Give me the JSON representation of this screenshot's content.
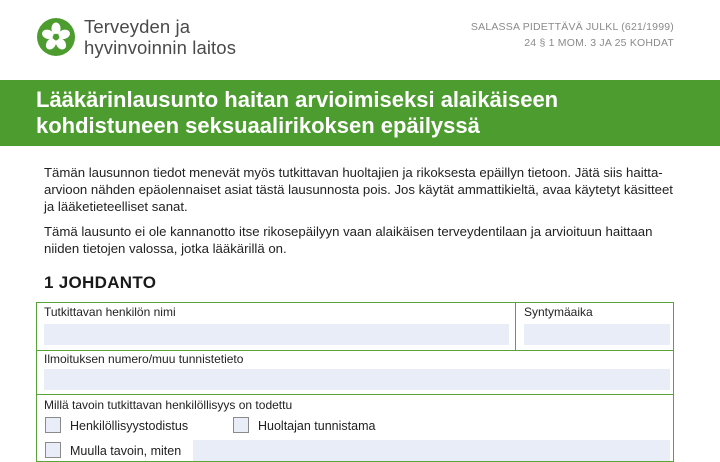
{
  "header": {
    "org_line1": "Terveyden ja",
    "org_line2": "hyvinvoinnin laitos",
    "classification_line1": "SALASSA PIDETTÄVÄ JULKL (621/1999)",
    "classification_line2": "24 § 1 MOM. 3 JA 25 KOHDAT"
  },
  "title": {
    "line1": "Lääkärinlausunto haitan arvioimiseksi alaikäiseen",
    "line2": "kohdistuneen seksuaalirikoksen epäilyssä"
  },
  "intro": {
    "paragraph1": "Tämän lausunnon tiedot menevät myös tutkittavan huoltajien ja rikoksesta epäillyn tietoon. Jätä siis haitta-arvioon nähden epäolennaiset asiat tästä lausunnosta pois. Jos käytät ammattikieltä, avaa käytetyt käsitteet ja lääketieteelliset sanat.",
    "paragraph2": "Tämä lausunto ei ole kannanotto itse rikosepäilyyn vaan alaikäisen terveydentilaan ja arvioituun haittaan niiden tietojen valossa, jotka lääkärillä on."
  },
  "section1": {
    "title": "1 JOHDANTO",
    "name_label": "Tutkittavan henkilön nimi",
    "name_value": "",
    "birth_label": "Syntymäaika",
    "birth_value": "",
    "notification_label": "Ilmoituksen numero/muu tunnistetieto",
    "notification_value": "",
    "identity_label": "Millä tavoin tutkittavan henkilöllisyys on todettu",
    "options": [
      "Henkilöllisyystodistus",
      "Huoltajan tunnistama",
      "Muulla tavoin, miten"
    ],
    "other_value": ""
  },
  "colors": {
    "brand_green": "#4d9c2f",
    "field_fill": "#e8edf8"
  }
}
